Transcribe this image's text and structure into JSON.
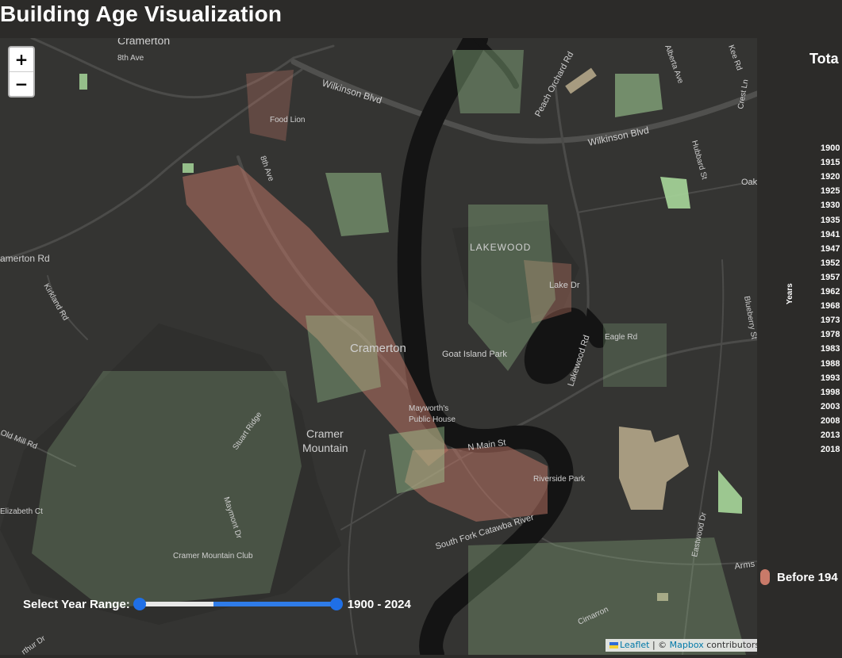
{
  "header": {
    "title": "Building Age Visualization"
  },
  "map": {
    "labels": {
      "cramerton_top": "Cramerton",
      "eighth_ave": "8th Ave",
      "wilkinson_blvd": "Wilkinson Blvd",
      "wilkinson_blvd_2": "Wilkinson Blvd",
      "food_lion": "Food Lion",
      "peach_orchard": "Peach Orchard Rd",
      "alberta_ave": "Alberta Ave",
      "kee_rd": "Kee Rd",
      "crest_ln": "Crest Ln",
      "hubbard_st": "Hubbard St",
      "oak": "Oak",
      "cramerton_rd": "amerton Rd",
      "kirkland_rd": "Kirkland Rd",
      "eighth_ave_2": "8th Ave",
      "lakewood_area": "LAKEWOOD",
      "lake_dr": "Lake Dr",
      "eagle_rd": "Eagle Rd",
      "blueberry_st": "Blueberry St",
      "cramerton_center": "Cramerton",
      "goat_island": "Goat Island Park",
      "lakewood_rd": "Lakewood Rd",
      "mayworths": "Mayworth's",
      "public_house": "Public House",
      "cramer_mountain_1": "Cramer",
      "cramer_mountain_2": "Mountain",
      "stuart_ridge": "Stuart Ridge",
      "old_mill_rd": "Old Mill Rd",
      "n_main_st": "N Main St",
      "riverside_park": "Riverside Park",
      "south_fork": "South Fork Catawba River",
      "elizabeth_ct": "Elizabeth Ct",
      "maymont_dr": "Maymont Dr",
      "cramer_mountain_club": "Cramer Mountain Club",
      "eastwood_dr": "Eastwood Dr",
      "armstrong": "Arms",
      "cimarron": "Cimarron",
      "arthur_dr": "rthur Dr"
    },
    "zoom": {
      "in_label": "+",
      "out_label": "−"
    },
    "attribution": {
      "leaflet": "Leaflet",
      "separator": " | © ",
      "mapbox": "Mapbox",
      "suffix": " contributors"
    }
  },
  "controls": {
    "year_range_label": "Select Year Range:",
    "year_range_value": "1900 - 2024",
    "range_min": 1900,
    "range_max": 2024,
    "selected_min": 1900,
    "selected_max": 2024
  },
  "chart": {
    "title": "Tota",
    "axis_label": "Years",
    "ticks": [
      "1900",
      "1915",
      "1920",
      "1925",
      "1930",
      "1935",
      "1941",
      "1947",
      "1952",
      "1957",
      "1962",
      "1968",
      "1973",
      "1978",
      "1983",
      "1988",
      "1993",
      "1998",
      "2003",
      "2008",
      "2013",
      "2018"
    ]
  },
  "legend": {
    "label": "Before 194"
  },
  "colors": {
    "old": "#c97a69",
    "mid": "#bcae8e",
    "new": "#a7d79a",
    "water": "#141414",
    "road": "#4b4b49",
    "accent": "#2f7ce8"
  }
}
